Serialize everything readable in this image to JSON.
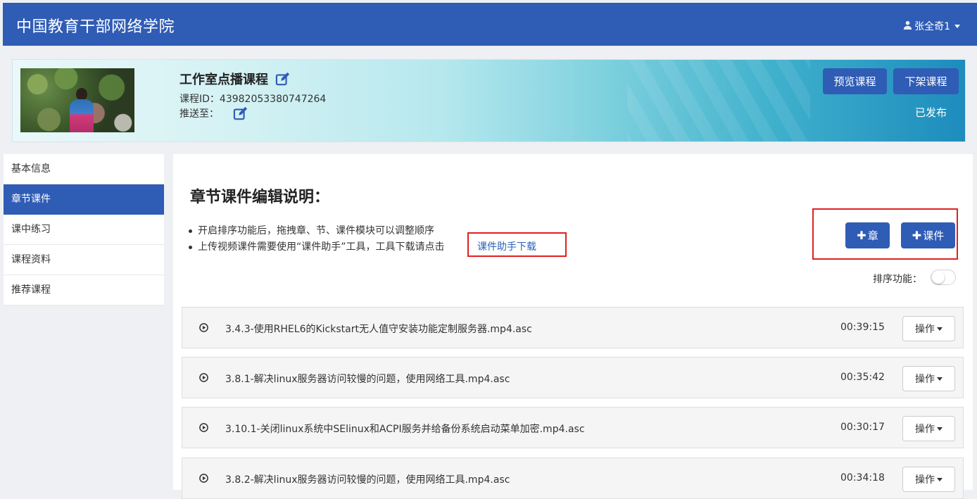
{
  "header": {
    "brand": "中国教育干部网络学院",
    "user": "张全奇1"
  },
  "course": {
    "title": "工作室点播课程",
    "id_text": "课程ID：43982053380747264",
    "push_label": "推送至：",
    "preview_label": "预览课程",
    "offline_label": "下架课程",
    "status": "已发布"
  },
  "sidebar": {
    "items": [
      {
        "label": "基本信息"
      },
      {
        "label": "章节课件"
      },
      {
        "label": "课中练习"
      },
      {
        "label": "课程资料"
      },
      {
        "label": "推荐课程"
      }
    ],
    "active_index": 1
  },
  "main": {
    "title": "章节课件编辑说明：",
    "notes": [
      "开启排序功能后，拖拽章、节、课件模块可以调整顺序",
      "上传视频课件需要使用“课件助手”工具，工具下载请点击"
    ],
    "download_link": "课件助手下载",
    "add_chapter": "章",
    "add_courseware": "课件",
    "sort_label": "排序功能：",
    "sort_enabled": false,
    "operate_label": "操作",
    "rows": [
      {
        "name": "3.4.3-使用RHEL6的Kickstart无人值守安装功能定制服务器.mp4.asc",
        "duration": "00:39:15"
      },
      {
        "name": "3.8.1-解决linux服务器访问较慢的问题，使用网络工具.mp4.asc",
        "duration": "00:35:42"
      },
      {
        "name": "3.10.1-关闭linux系统中SElinux和ACPI服务并给备份系统启动菜单加密.mp4.asc",
        "duration": "00:30:17"
      },
      {
        "name": "3.8.2-解决linux服务器访问较慢的问题，使用网络工具.mp4.asc",
        "duration": "00:34:18"
      }
    ]
  },
  "colors": {
    "primary": "#2f5cb5",
    "highlight_box": "#e02020",
    "link": "#2a62b8"
  }
}
